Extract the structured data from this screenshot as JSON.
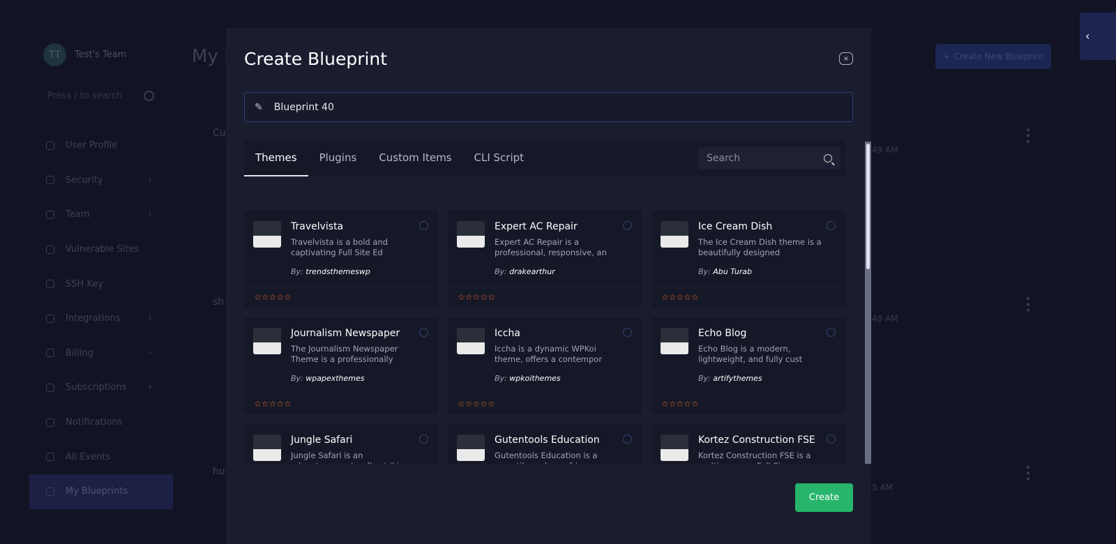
{
  "background": {
    "team": {
      "initials": "TT",
      "name": "Test's Team"
    },
    "search_placeholder": "Press / to search",
    "nav": [
      {
        "label": "User Profile",
        "icon": "user-icon",
        "chevron": false
      },
      {
        "label": "Security",
        "icon": "shield-icon",
        "chevron": true
      },
      {
        "label": "Team",
        "icon": "team-icon",
        "chevron": true
      },
      {
        "label": "Vulnerable Sites",
        "icon": "bug-icon",
        "chevron": false
      },
      {
        "label": "SSH Key",
        "icon": "key-icon",
        "chevron": false
      },
      {
        "label": "Integrations",
        "icon": "gear-icon",
        "chevron": true
      },
      {
        "label": "Billing",
        "icon": "billing-icon",
        "chevron": true
      },
      {
        "label": "Subscriptions",
        "icon": "subscription-icon",
        "chevron": true
      },
      {
        "label": "Notifications",
        "icon": "bell-icon",
        "chevron": false
      },
      {
        "label": "All Events",
        "icon": "activity-icon",
        "chevron": false
      },
      {
        "label": "My Blueprints",
        "icon": "blueprint-icon",
        "chevron": false,
        "active": true
      }
    ],
    "page_title": "My B",
    "create_new_label": "Create New Blueprint",
    "items": [
      {
        "name": "Cu",
        "times": "49 AM"
      },
      {
        "name": "sh",
        "times": "48 AM"
      },
      {
        "name": "hu",
        "times": "5 AM"
      }
    ]
  },
  "modal": {
    "title": "Create Blueprint",
    "name_value": "Blueprint 40",
    "tabs": [
      "Themes",
      "Plugins",
      "Custom Items",
      "CLI Script"
    ],
    "active_tab": "Themes",
    "search_placeholder": "Search",
    "themes": [
      {
        "name": "Travelvista",
        "desc": "Travelvista is a bold and captivating Full Site Ed",
        "by": "trendsthemeswp",
        "rating": 0
      },
      {
        "name": "Expert AC Repair",
        "desc": "Expert AC Repair is a professional, responsive, an",
        "by": "drakearthur",
        "rating": 0
      },
      {
        "name": "Ice Cream Dish",
        "desc": "The Ice Cream Dish theme is a beautifully designed",
        "by": "Abu Turab",
        "rating": 0
      },
      {
        "name": "Journalism Newspaper",
        "desc": "The Journalism Newspaper Theme is a professionally",
        "by": "wpapexthemes",
        "rating": 0
      },
      {
        "name": "Iccha",
        "desc": "Iccha is a dynamic WPKoi theme, offers a contempor",
        "by": "wpkoithemes",
        "rating": 0
      },
      {
        "name": "Echo Blog",
        "desc": "Echo Blog is a modern, lightweight, and fully cust",
        "by": "artifythemes",
        "rating": 0
      },
      {
        "name": "Jungle Safari",
        "desc": "Jungle Safari is an adventurous, visually striking",
        "by": "",
        "rating": 0
      },
      {
        "name": "Gutentools Education",
        "desc": "Gutentools Education is a versatile and user-frien",
        "by": "",
        "rating": 0
      },
      {
        "name": "Kortez Construction FSE",
        "desc": "Kortez Construction FSE is a multi-purpose Full Si",
        "by": "",
        "rating": 0
      }
    ],
    "by_prefix": "By:",
    "create_label": "Create",
    "colors": {
      "accent": "#27b56b",
      "star": "#e46a2a",
      "bg": "#1a1d2e"
    }
  }
}
